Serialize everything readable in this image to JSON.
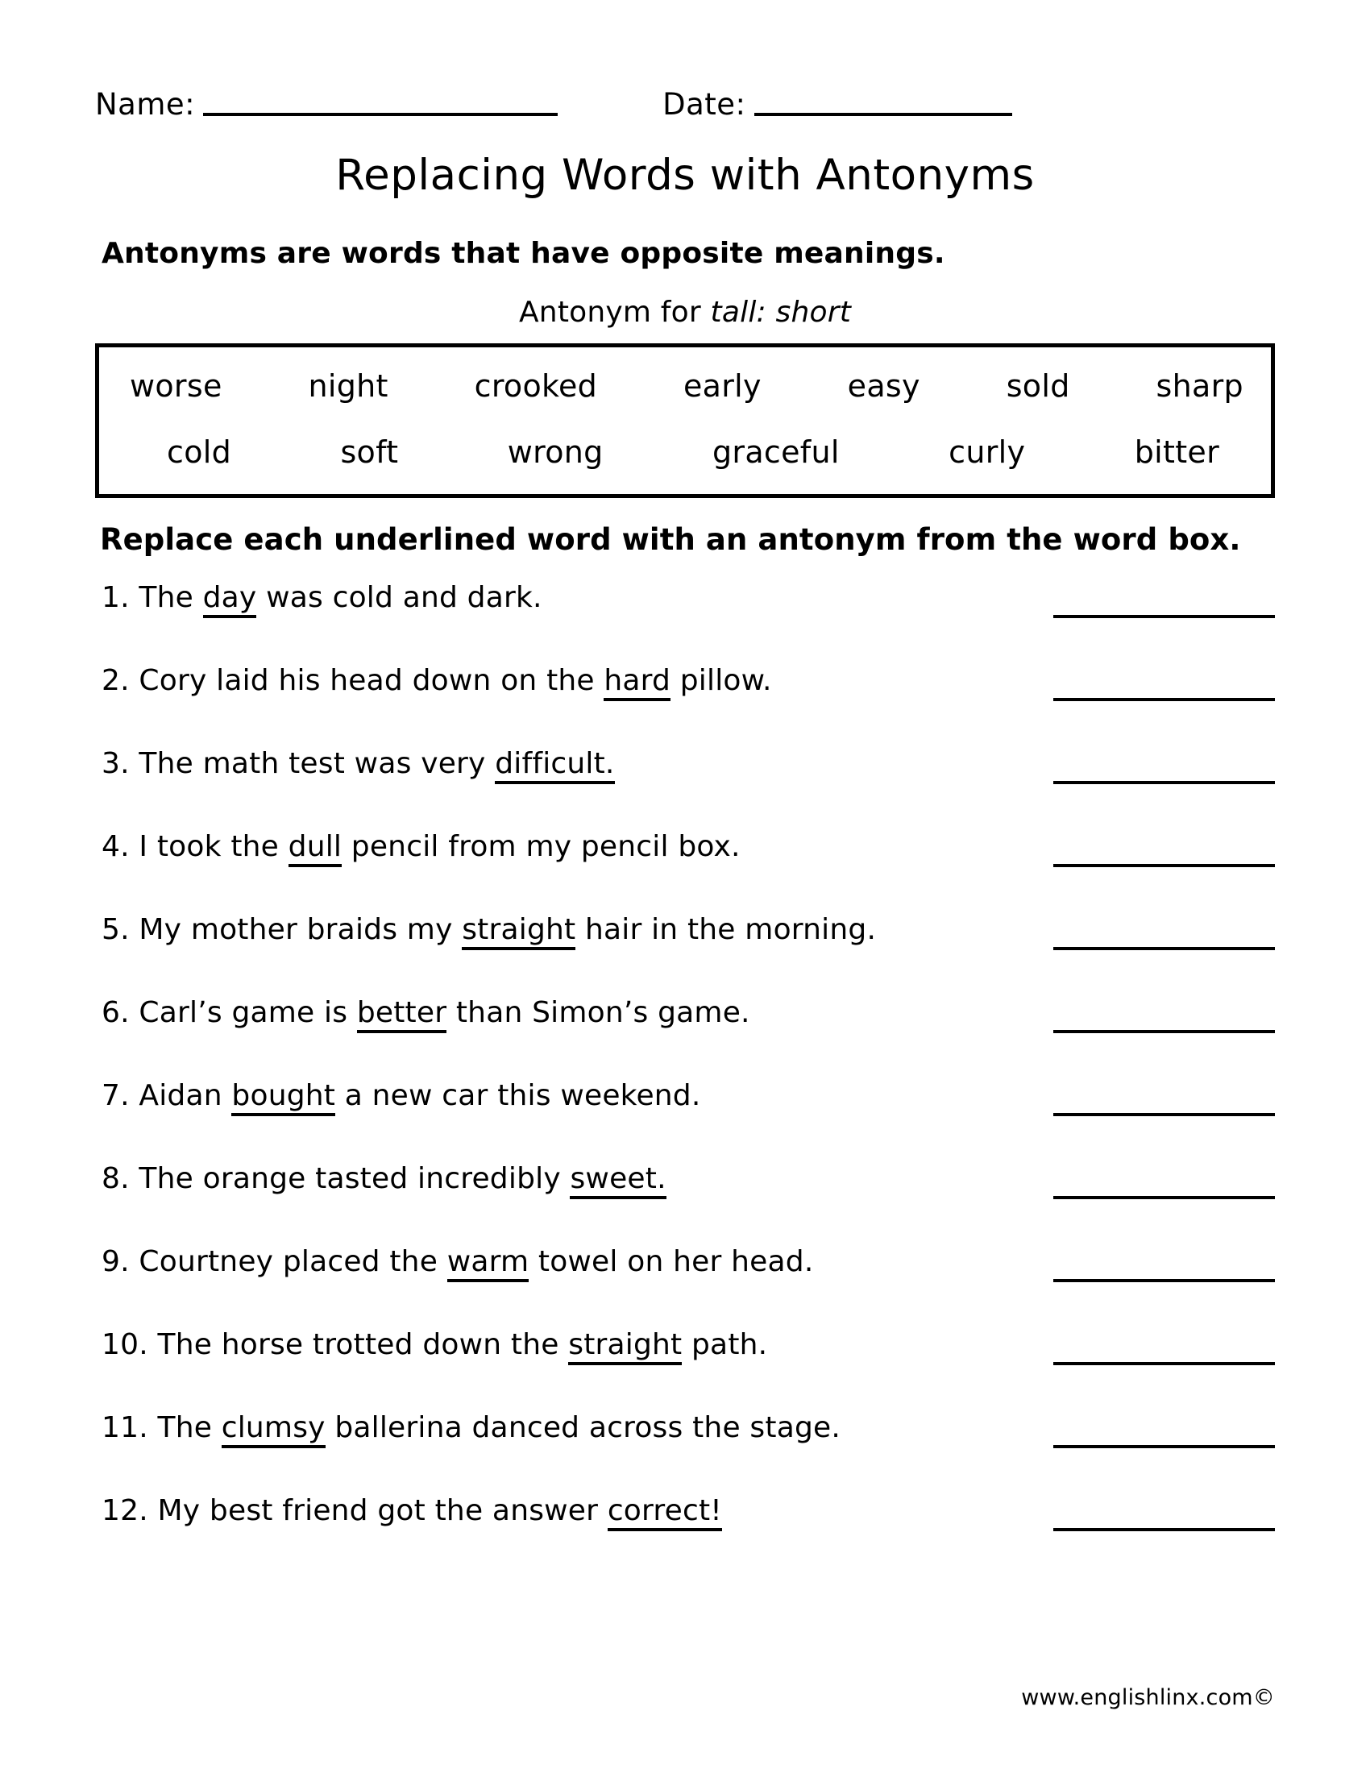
{
  "header": {
    "name_label": "Name:",
    "date_label": "Date:"
  },
  "title": "Replacing Words with Antonyms",
  "intro": "Antonyms are words that have opposite meanings.",
  "example": {
    "prefix": "Antonym for ",
    "pair": "tall: short"
  },
  "word_box": {
    "row1": [
      "worse",
      "night",
      "crooked",
      "early",
      "easy",
      "sold",
      "sharp"
    ],
    "row2": [
      "cold",
      "soft",
      "wrong",
      "graceful",
      "curly",
      "bitter"
    ]
  },
  "directions": "Replace each underlined word with an antonym from the word box.",
  "questions": [
    {
      "number": "1.",
      "before": "The ",
      "underlined": "day",
      "after": " was cold and dark."
    },
    {
      "number": "2.",
      "before": "Cory laid his head down on the ",
      "underlined": "hard",
      "after": " pillow."
    },
    {
      "number": "3.",
      "before": "The math test was very ",
      "underlined": "difficult.",
      "after": ""
    },
    {
      "number": "4.",
      "before": "I took the ",
      "underlined": "dull",
      "after": " pencil from my pencil box."
    },
    {
      "number": "5.",
      "before": "My mother braids my ",
      "underlined": "straight",
      "after": " hair in the morning."
    },
    {
      "number": "6.",
      "before": "Carl’s game is ",
      "underlined": "better",
      "after": " than Simon’s game."
    },
    {
      "number": "7.",
      "before": "Aidan ",
      "underlined": "bought",
      "after": " a new car this weekend."
    },
    {
      "number": "8.",
      "before": "The orange tasted incredibly ",
      "underlined": "sweet.",
      "after": ""
    },
    {
      "number": "9.",
      "before": "Courtney placed the ",
      "underlined": "warm",
      "after": " towel on her head."
    },
    {
      "number": "10.",
      "before": "The horse trotted down the ",
      "underlined": "straight",
      "after": " path."
    },
    {
      "number": "11.",
      "before": "The ",
      "underlined": "clumsy",
      "after": " ballerina danced across the stage."
    },
    {
      "number": "12.",
      "before": "My best friend got the answer ",
      "underlined": "correct!",
      "after": ""
    }
  ],
  "footer": "www.englishlinx.com©"
}
